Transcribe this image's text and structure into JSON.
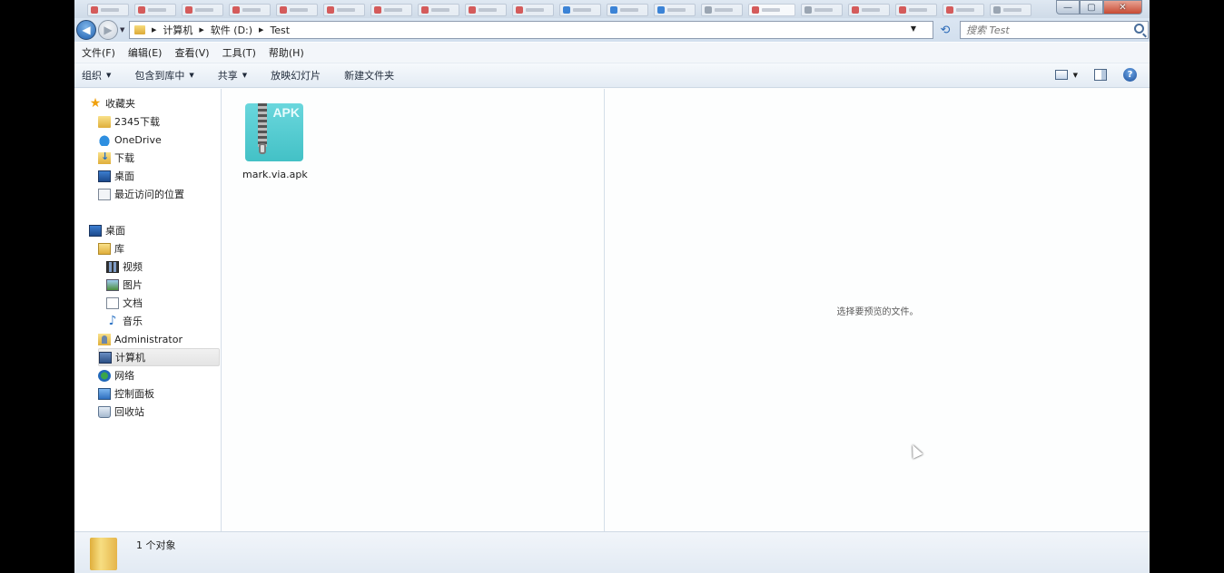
{
  "window": {
    "controls": {
      "minimize": "—",
      "maximize": "▢",
      "close": "✕"
    }
  },
  "address": {
    "back": "◀",
    "forward": "▶",
    "crumbs": [
      "计算机",
      "软件 (D:)",
      "Test"
    ],
    "refresh": "⟲",
    "search_placeholder": "搜索 Test"
  },
  "menubar": [
    "文件(F)",
    "编辑(E)",
    "查看(V)",
    "工具(T)",
    "帮助(H)"
  ],
  "toolbar": {
    "buttons": [
      "组织",
      "包含到库中",
      "共享",
      "放映幻灯片",
      "新建文件夹"
    ],
    "help": "?"
  },
  "sidebar": {
    "favorites_label": "收藏夹",
    "favorites": [
      "2345下载",
      "OneDrive",
      "下载",
      "桌面",
      "最近访问的位置"
    ],
    "desktop_label": "桌面",
    "library_label": "库",
    "library_items": [
      "视频",
      "图片",
      "文档",
      "音乐"
    ],
    "others": [
      "Administrator",
      "计算机",
      "网络",
      "控制面板",
      "回收站"
    ]
  },
  "files": [
    {
      "name": "mark.via.apk",
      "badge": "APK"
    }
  ],
  "preview": {
    "message": "选择要预览的文件。"
  },
  "status": {
    "count_text": "1 个对象"
  }
}
